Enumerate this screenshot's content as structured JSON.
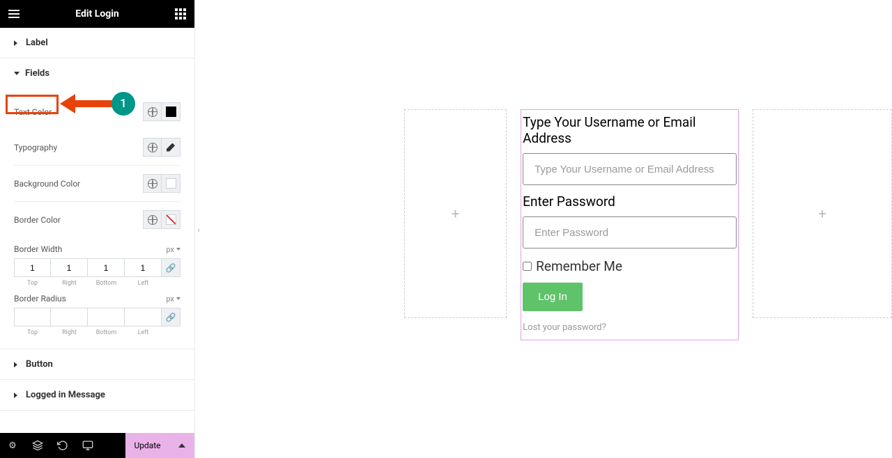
{
  "header": {
    "title": "Edit Login"
  },
  "annotations": {
    "badge_number": "1"
  },
  "accordion": {
    "label": "Label",
    "fields": "Fields",
    "button": "Button",
    "logged_in_message": "Logged in Message"
  },
  "controls": {
    "text_color": "Text Color",
    "typography": "Typography",
    "background_color": "Background Color",
    "border_color": "Border Color",
    "border_width": "Border Width",
    "border_radius": "Border Radius",
    "unit": "px",
    "bw": {
      "top": "1",
      "right": "1",
      "bottom": "1",
      "left": "1"
    },
    "br": {
      "top": "",
      "right": "",
      "bottom": "",
      "left": ""
    },
    "side_labels": {
      "top": "Top",
      "right": "Right",
      "bottom": "Bottom",
      "left": "Left"
    }
  },
  "bottom": {
    "update": "Update"
  },
  "login": {
    "username_label": "Type Your Username or Email Address",
    "username_placeholder": "Type Your Username or Email Address",
    "password_label": "Enter Password",
    "password_placeholder": "Enter Password",
    "remember": "Remember Me",
    "button": "Log In",
    "lost": "Lost your password?"
  }
}
